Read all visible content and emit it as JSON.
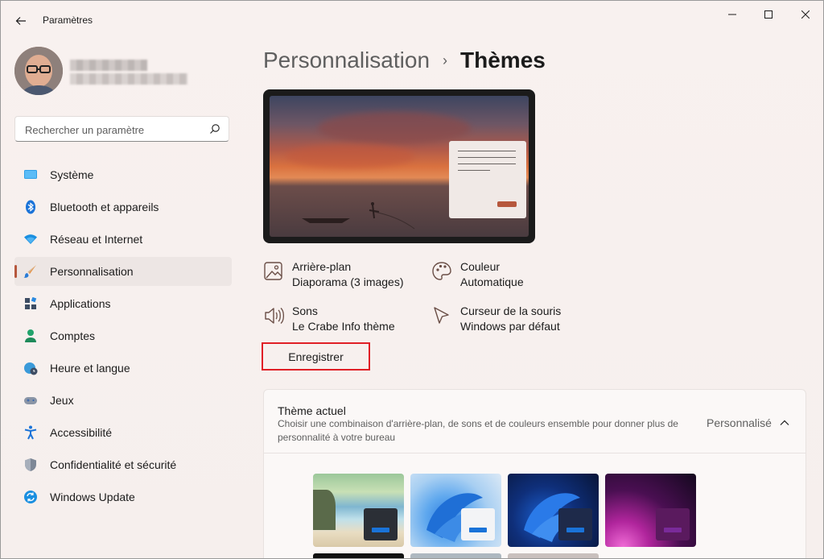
{
  "window": {
    "title": "Paramètres"
  },
  "search": {
    "placeholder": "Rechercher un paramètre"
  },
  "sidebar": {
    "items": [
      {
        "label": "Système",
        "icon": "monitor-icon",
        "active": false
      },
      {
        "label": "Bluetooth et appareils",
        "icon": "bluetooth-icon",
        "active": false
      },
      {
        "label": "Réseau et Internet",
        "icon": "wifi-icon",
        "active": false
      },
      {
        "label": "Personnalisation",
        "icon": "brush-icon",
        "active": true
      },
      {
        "label": "Applications",
        "icon": "apps-icon",
        "active": false
      },
      {
        "label": "Comptes",
        "icon": "person-icon",
        "active": false
      },
      {
        "label": "Heure et langue",
        "icon": "globe-clock-icon",
        "active": false
      },
      {
        "label": "Jeux",
        "icon": "gamepad-icon",
        "active": false
      },
      {
        "label": "Accessibilité",
        "icon": "accessibility-icon",
        "active": false
      },
      {
        "label": "Confidentialité et sécurité",
        "icon": "shield-icon",
        "active": false
      },
      {
        "label": "Windows Update",
        "icon": "update-icon",
        "active": false
      }
    ]
  },
  "breadcrumb": {
    "parent": "Personnalisation",
    "separator": "›",
    "current": "Thèmes"
  },
  "properties": {
    "background": {
      "title": "Arrière-plan",
      "value": "Diaporama (3 images)",
      "icon": "image-icon"
    },
    "color": {
      "title": "Couleur",
      "value": "Automatique",
      "icon": "palette-icon"
    },
    "sounds": {
      "title": "Sons",
      "value": "Le Crabe Info thème",
      "icon": "speaker-icon"
    },
    "cursor": {
      "title": "Curseur de la souris",
      "value": "Windows par défaut",
      "icon": "cursor-icon"
    }
  },
  "save_button": {
    "label": "Enregistrer"
  },
  "current_theme": {
    "title": "Thème actuel",
    "description": "Choisir une combinaison d'arrière-plan, de sons et de couleurs ensemble pour donner plus de personnalité à votre bureau",
    "value": "Personnalisé"
  },
  "themes": [
    {
      "name": "beach",
      "accent": "#0f6cbd"
    },
    {
      "name": "windows-light",
      "accent": "#0f6cbd"
    },
    {
      "name": "windows-dark",
      "accent": "#0f6cbd"
    },
    {
      "name": "glow",
      "accent": "#5e2b8c"
    }
  ],
  "colors": {
    "accent": "#b6573d",
    "highlight": "#e01f26"
  }
}
